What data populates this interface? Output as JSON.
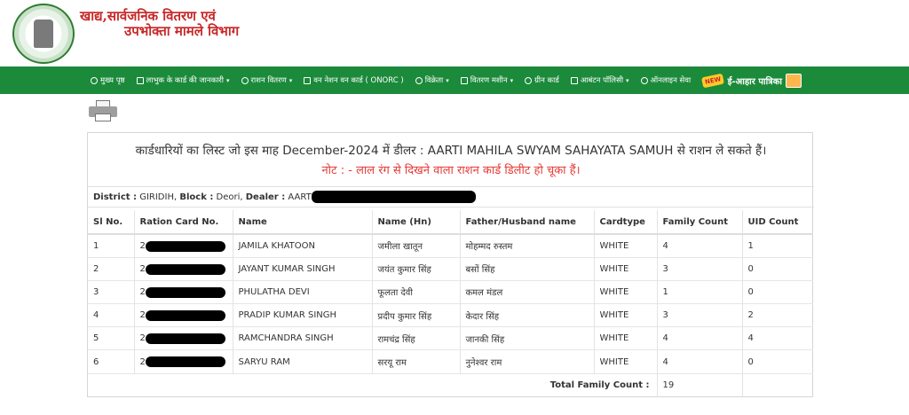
{
  "header": {
    "title_line1": "खाद्य,सार्वजनिक वितरण एवं",
    "title_line2": "उपभोक्ता मामले विभाग",
    "emblem_icon": "state-emblem-icon"
  },
  "nav": {
    "items": [
      {
        "label": "मुख्य पृष्ठ",
        "icon": "home-icon",
        "dropdown": false
      },
      {
        "label": "लाभुक के कार्ड की जानकारी",
        "icon": "card-icon",
        "dropdown": true
      },
      {
        "label": "राशन वितरण",
        "icon": "truck-icon",
        "dropdown": true
      },
      {
        "label": "वन नेशन वन कार्ड ( ONORC )",
        "icon": "globe-icon",
        "dropdown": false
      },
      {
        "label": "विक्रेता",
        "icon": "user-icon",
        "dropdown": true
      },
      {
        "label": "वितरण मशीन",
        "icon": "machine-icon",
        "dropdown": true
      },
      {
        "label": "ग्रीन कार्ड",
        "icon": "shuffle-icon",
        "dropdown": false
      },
      {
        "label": "आबंटन पॉलिसी",
        "icon": "bag-icon",
        "dropdown": true
      },
      {
        "label": "ऑनलाइन सेवा",
        "icon": "globe-icon",
        "dropdown": false
      }
    ],
    "new_badge": "NEW",
    "eahar_label": "ई-आहार पात्रिका"
  },
  "report": {
    "heading": "कार्डधारियों का लिस्ट जो इस माह December-2024 में डीलर : AARTI MAHILA SWYAM SAHAYATA SAMUH से राशन ले सकते हैं।",
    "note": "नोट : - लाल रंग से दिखने वाला राशन कार्ड डिलीट हो चूका हैं।",
    "district_label": "District :",
    "district": "GIRIDIH,",
    "block_label": "Block :",
    "block": "Deori,",
    "dealer_label": "Dealer :",
    "dealer_visible": "AART"
  },
  "table": {
    "headers": [
      "Sl No.",
      "Ration Card No.",
      "Name",
      "Name (Hn)",
      "Father/Husband name",
      "Cardtype",
      "Family Count",
      "UID Count"
    ],
    "rows": [
      {
        "sl": "1",
        "rc_prefix": "2",
        "name": "JAMILA KHATOON",
        "name_hn": "जमीला खातून",
        "father": "मोहम्मद रुस्तम",
        "cardtype": "WHITE",
        "family": "4",
        "uid": "1"
      },
      {
        "sl": "2",
        "rc_prefix": "2",
        "name": "JAYANT KUMAR SINGH",
        "name_hn": "जयंत कुमार सिंह",
        "father": "बसों सिंह",
        "cardtype": "WHITE",
        "family": "3",
        "uid": "0"
      },
      {
        "sl": "3",
        "rc_prefix": "2",
        "name": "PHULATHA DEVI",
        "name_hn": "फूलता देवी",
        "father": "कमल मंडल",
        "cardtype": "WHITE",
        "family": "1",
        "uid": "0"
      },
      {
        "sl": "4",
        "rc_prefix": "2",
        "name": "PRADIP KUMAR SINGH",
        "name_hn": "प्रदीप कुमार सिंह",
        "father": "केदार सिंह",
        "cardtype": "WHITE",
        "family": "3",
        "uid": "2"
      },
      {
        "sl": "5",
        "rc_prefix": "2",
        "name": "RAMCHANDRA SINGH",
        "name_hn": "रामचंद्र सिंह",
        "father": "जानकी सिंह",
        "cardtype": "WHITE",
        "family": "4",
        "uid": "4"
      },
      {
        "sl": "6",
        "rc_prefix": "2",
        "name": "SARYU RAM",
        "name_hn": "सरयू राम",
        "father": "नुनेश्वर राम",
        "cardtype": "WHITE",
        "family": "4",
        "uid": "0"
      }
    ],
    "total_label": "Total Family Count :",
    "total_value": "19"
  },
  "colors": {
    "nav_bg": "#1b8a3b",
    "title_red": "#c62828",
    "note_red": "#e53935"
  }
}
